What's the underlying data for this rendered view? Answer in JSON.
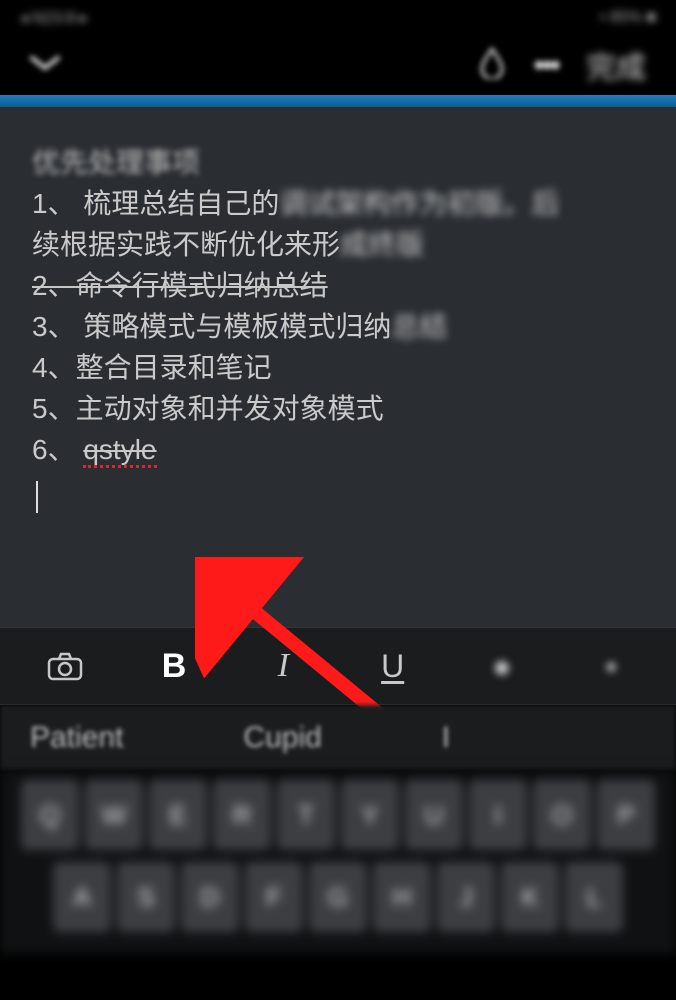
{
  "status_bar": {
    "left_blur": "◂ N23:8 ▸",
    "right_blur": "• 85% ■"
  },
  "header": {
    "done_label": "完成"
  },
  "note": {
    "title": "优先处理事项",
    "items": [
      {
        "num": "1、",
        "clear": " 梳理总结自己的",
        "blur_end": "调试架构作为初版。后"
      },
      {
        "num": "",
        "clear": "续根据实践不断优化来形",
        "blur_end": "成终版"
      },
      {
        "num": "2、",
        "clear": "命令行模式归纳总结",
        "strike": true
      },
      {
        "num": "3、",
        "clear": " 策略模式与模板模式归纳",
        "blur_end": "总结"
      },
      {
        "num": "4、",
        "clear": "整合目录和笔记"
      },
      {
        "num": "5、",
        "clear": "主动对象和并发对象模式"
      },
      {
        "num": "6、 ",
        "qstyle": "qstyle"
      }
    ]
  },
  "toolbar": {
    "bold": "B",
    "italic": "I",
    "underline": "U"
  },
  "suggestions": {
    "s1": "Patient",
    "s2": "Cupid",
    "s3": "I"
  },
  "keyboard_rows": [
    [
      "Q",
      "W",
      "E",
      "R",
      "T",
      "Y",
      "U",
      "I",
      "O",
      "P"
    ],
    [
      "A",
      "S",
      "D",
      "F",
      "G",
      "H",
      "J",
      "K",
      "L"
    ]
  ]
}
